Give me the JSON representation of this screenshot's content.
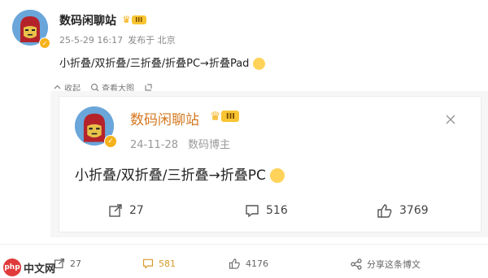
{
  "post": {
    "author": "数码闲聊站",
    "level": "III",
    "time": "25-5-29 16:17",
    "location": "发布于 北京",
    "text": "小折叠/双折叠/三折叠/折叠PC→折叠Pad",
    "actions": {
      "collapse": "收起",
      "view_large": "查看大图"
    }
  },
  "repost": {
    "author": "数码闲聊站",
    "level": "III",
    "time": "24-11-28",
    "source": "数码博主",
    "text": "小折叠/双折叠/三折叠→折叠PC",
    "counts": {
      "reposts": "27",
      "comments": "516",
      "likes": "3769"
    }
  },
  "footer": {
    "reposts": "27",
    "comments": "581",
    "likes": "4176",
    "share_label": "分享这条博文"
  },
  "watermark": {
    "badge": "php",
    "text": "中文网"
  },
  "colors": {
    "accent": "#f6b21a",
    "comment_highlight": "#d89a2a",
    "badge_red": "#e03a3a"
  },
  "icons": [
    "collapse-icon",
    "view-large-icon",
    "close-icon",
    "repost-icon",
    "comment-icon",
    "like-icon",
    "share-icon",
    "verified-icon",
    "crown-icon"
  ]
}
